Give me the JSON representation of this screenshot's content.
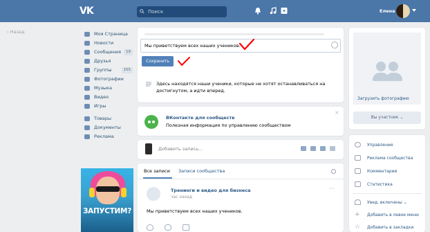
{
  "header": {
    "logo": "VK",
    "search_placeholder": "Поиск",
    "user_name": "Елена"
  },
  "back_label": "Назад",
  "sidebar": {
    "items": [
      {
        "label": "Моя Страница",
        "icon": "home-icon",
        "badge": ""
      },
      {
        "label": "Новости",
        "icon": "news-icon",
        "badge": ""
      },
      {
        "label": "Сообщения",
        "icon": "messages-icon",
        "badge": "19"
      },
      {
        "label": "Друзья",
        "icon": "friends-icon",
        "badge": ""
      },
      {
        "label": "Группы",
        "icon": "groups-icon",
        "badge": "155"
      },
      {
        "label": "Фотографии",
        "icon": "photos-icon",
        "badge": ""
      },
      {
        "label": "Музыка",
        "icon": "music-icon",
        "badge": ""
      },
      {
        "label": "Видео",
        "icon": "video-icon",
        "badge": ""
      },
      {
        "label": "Игры",
        "icon": "games-icon",
        "badge": ""
      },
      {
        "label": "Товары",
        "icon": "goods-icon",
        "badge": ""
      },
      {
        "label": "Документы",
        "icon": "documents-icon",
        "badge": ""
      },
      {
        "label": "Реклама",
        "icon": "ads-icon",
        "badge": ""
      }
    ]
  },
  "ad": {
    "text": "ЗАПУСТИМ?"
  },
  "status": {
    "value": "Мы приветствуем всех наших учеников.",
    "save_label": "Сохранить",
    "hint": "Здесь находятся наши ученики, которые не хотят останавливаться на достигнутом, а идти вперед."
  },
  "community": {
    "title": "ВКонтакте для сообществ",
    "description": "Полезная информация по управлению сообществом",
    "close": "×"
  },
  "new_post": {
    "placeholder": "Добавить запись..."
  },
  "feed": {
    "tabs": [
      "Все записи",
      "Записи сообщества"
    ],
    "post": {
      "author": "Тренинги и видео для бизнеса",
      "time": "час назад",
      "text": "Мы приветствуем всех наших учеников.",
      "more": "···"
    }
  },
  "right": {
    "upload_label": "Загрузить фотографию",
    "member_label": "Вы участник ⌄",
    "menu": [
      {
        "label": "Управление",
        "icon": "settings-icon"
      },
      {
        "label": "Реклама сообщества",
        "icon": "megaphone-icon"
      },
      {
        "label": "Комментарии",
        "icon": "comments-icon"
      },
      {
        "label": "Статистика",
        "icon": "statistics-icon"
      },
      {
        "label": "Увед. включены ⌄",
        "icon": "bell-icon"
      },
      {
        "label": "Добавить в левое меню",
        "icon": "plus-icon"
      },
      {
        "label": "Добавить в закладки",
        "icon": "star-icon"
      }
    ]
  },
  "colors": {
    "brand": "#4a76a8",
    "button": "#5181b8",
    "link": "#2a5885",
    "annotation": "#ff0000"
  }
}
